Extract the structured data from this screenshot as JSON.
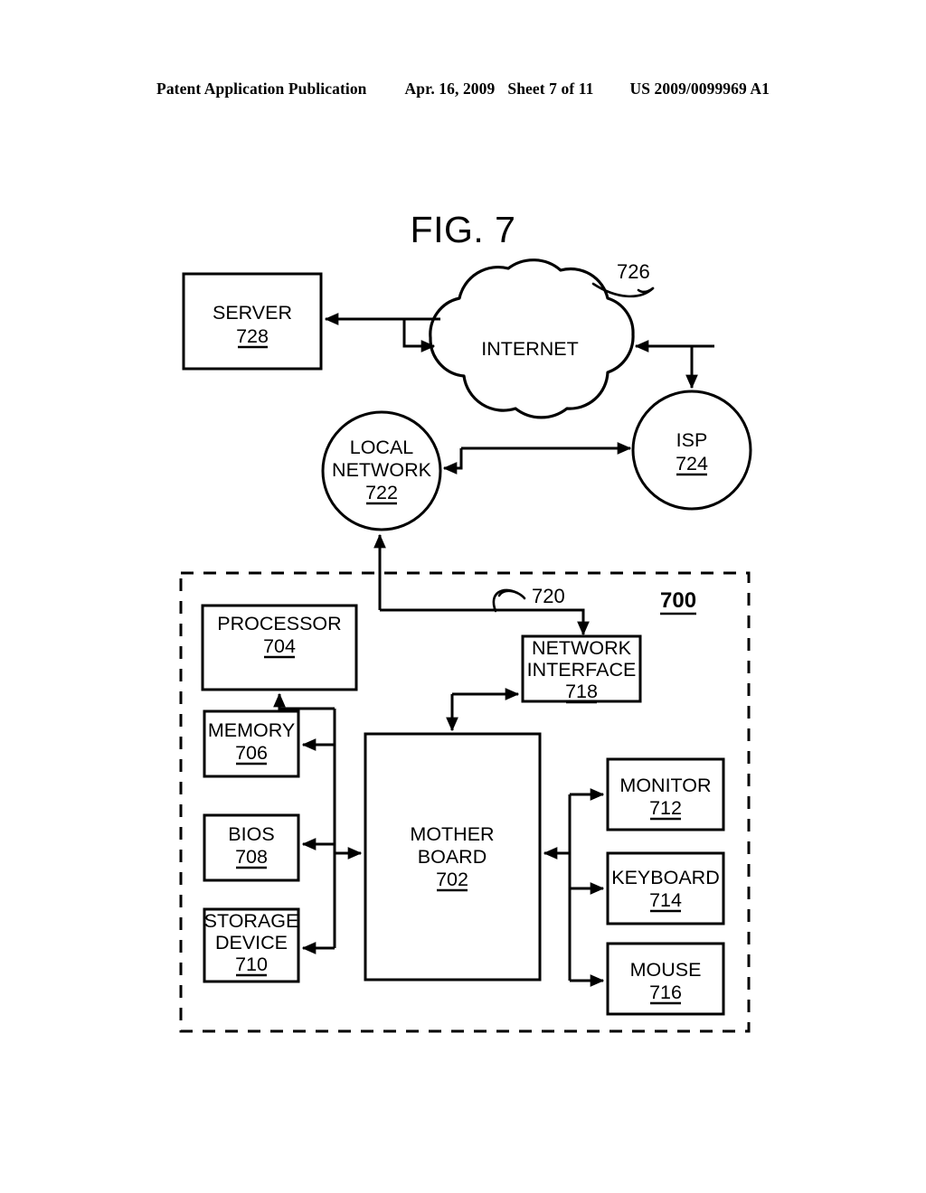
{
  "header": {
    "publication": "Patent Application Publication",
    "date": "Apr. 16, 2009",
    "sheet": "Sheet 7 of 11",
    "patent_number": "US 2009/0099969 A1"
  },
  "figure": {
    "title": "FIG. 7",
    "enclosure_ref": "700"
  },
  "nodes": {
    "server": {
      "label": "SERVER",
      "ref": "728"
    },
    "internet": {
      "label": "INTERNET",
      "ref": "726"
    },
    "isp": {
      "label": "ISP",
      "ref": "724"
    },
    "local_network": {
      "label_line1": "LOCAL",
      "label_line2": "NETWORK",
      "ref": "722"
    },
    "processor": {
      "label": "PROCESSOR",
      "ref": "704"
    },
    "network_interface": {
      "label_line1": "NETWORK",
      "label_line2": "INTERFACE",
      "ref": "718"
    },
    "memory": {
      "label": "MEMORY",
      "ref": "706"
    },
    "bios": {
      "label": "BIOS",
      "ref": "708"
    },
    "storage_device": {
      "label_line1": "STORAGE",
      "label_line2": "DEVICE",
      "ref": "710"
    },
    "motherboard": {
      "label_line1": "MOTHER",
      "label_line2": "BOARD",
      "ref": "702"
    },
    "monitor": {
      "label": "MONITOR",
      "ref": "712"
    },
    "keyboard": {
      "label": "KEYBOARD",
      "ref": "714"
    },
    "mouse": {
      "label": "MOUSE",
      "ref": "716"
    }
  },
  "connector_labels": {
    "network_link": "720",
    "internet_link": "726"
  },
  "colors": {
    "ink": "#000000",
    "paper": "#ffffff"
  }
}
